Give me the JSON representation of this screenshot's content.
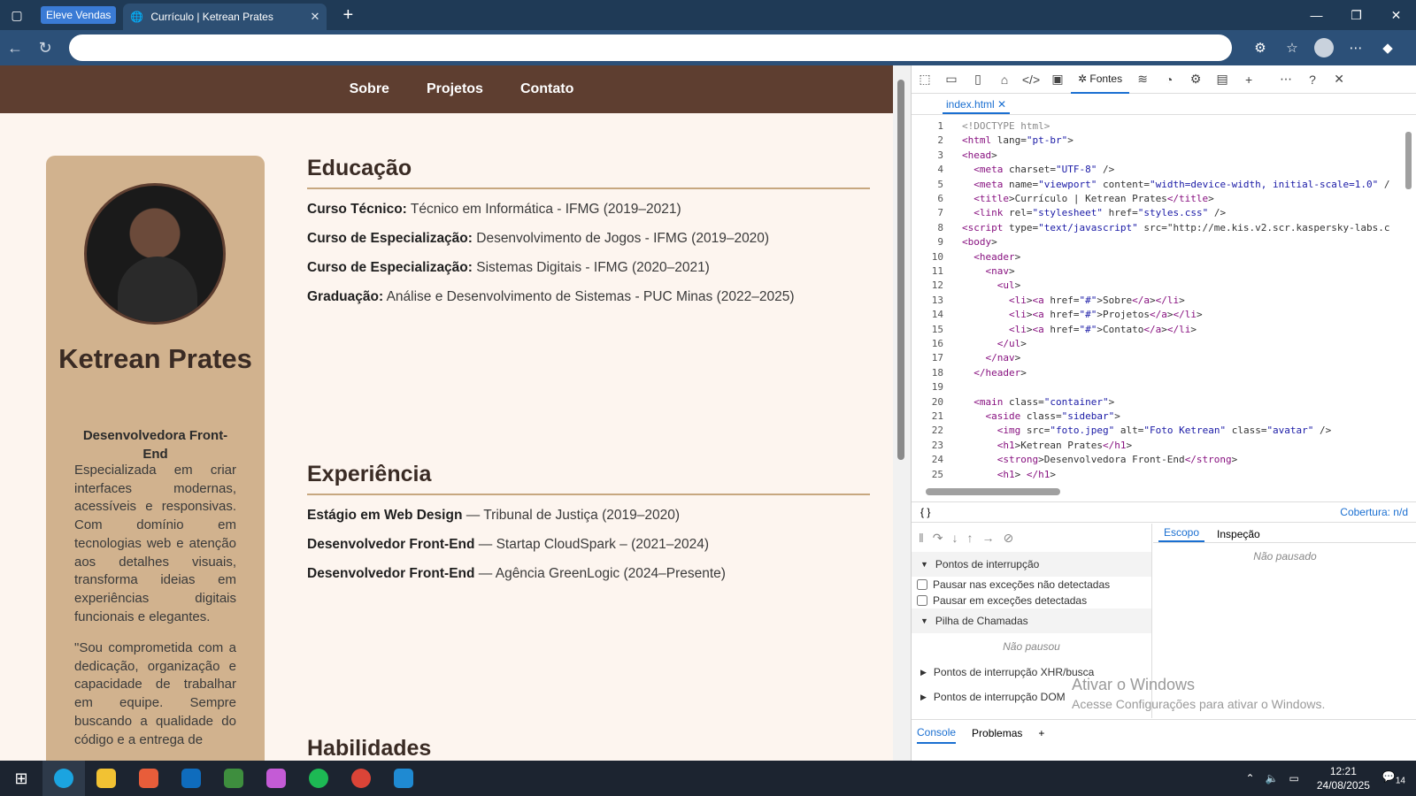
{
  "browser": {
    "group_label": "Eleve Vendas",
    "tab_title": "Currículo | Ketrean Prates",
    "url": "",
    "controls": {
      "min": "—",
      "max": "❐",
      "close": "✕"
    }
  },
  "site": {
    "nav": [
      "Sobre",
      "Projetos",
      "Contato"
    ],
    "sidebar": {
      "name": "Ketrean Prates",
      "role": "Desenvolvedora Front-End",
      "bio": "Especializada em criar interfaces modernas, acessíveis e responsivas. Com domínio em tecnologias web e atenção aos detalhes visuais, transforma ideias em experiências digitais funcionais e elegantes.",
      "quote": "\"Sou comprometida com a dedicação, organização e capacidade de trabalhar em equipe. Sempre buscando a qualidade do código e a entrega de"
    },
    "education": {
      "title": "Educação",
      "items": [
        {
          "label": "Curso Técnico:",
          "text": "Técnico em Informática - IFMG (2019–2021)"
        },
        {
          "label": "Curso de Especialização:",
          "text": "Desenvolvimento de Jogos - IFMG (2019–2020)"
        },
        {
          "label": "Curso de Especialização:",
          "text": "Sistemas Digitais - IFMG (2020–2021)"
        },
        {
          "label": "Graduação:",
          "text": "Análise e Desenvolvimento de Sistemas - PUC Minas (2022–2025)"
        }
      ]
    },
    "experience": {
      "title": "Experiência",
      "items": [
        {
          "label": "Estágio em Web Design",
          "text": "— Tribunal de Justiça (2019–2020)"
        },
        {
          "label": "Desenvolvedor Front-End",
          "text": "— Startap CloudSpark – (2021–2024)"
        },
        {
          "label": "Desenvolvedor Front-End",
          "text": "— Agência GreenLogic (2024–Presente)"
        }
      ]
    },
    "skills": {
      "title": "Habilidades"
    }
  },
  "devtools": {
    "active_tool": "Fontes",
    "file": "index.html",
    "code_lines": [
      "<!DOCTYPE html>",
      "<html lang=\"pt-br\">",
      "<head>",
      "  <meta charset=\"UTF-8\" />",
      "  <meta name=\"viewport\" content=\"width=device-width, initial-scale=1.0\" /",
      "  <title>Currículo | Ketrean Prates</title>",
      "  <link rel=\"stylesheet\" href=\"styles.css\" />",
      "<script type=\"text/javascript\" src=\"http://me.kis.v2.scr.kaspersky-labs.c",
      "<body>",
      "  <header>",
      "    <nav>",
      "      <ul>",
      "        <li><a href=\"#\">Sobre</a></li>",
      "        <li><a href=\"#\">Projetos</a></li>",
      "        <li><a href=\"#\">Contato</a></li>",
      "      </ul>",
      "    </nav>",
      "  </header>",
      "",
      "  <main class=\"container\">",
      "    <aside class=\"sidebar\">",
      "      <img src=\"foto.jpeg\" alt=\"Foto Ketrean\" class=\"avatar\" />",
      "      <h1>Ketrean Prates</h1>",
      "      <strong>Desenvolvedora Front-End</strong>",
      "      <h1> </h1>"
    ],
    "braces": "{ }",
    "coverage": "Cobertura: n/d",
    "breakpoints": "Pontos de interrupção",
    "pause_uncaught": "Pausar nas exceções não detectadas",
    "pause_caught": "Pausar em exceções detectadas",
    "call_stack": "Pilha de Chamadas",
    "not_paused": "Não pausou",
    "xhr_bp": "Pontos de interrupção XHR/busca",
    "dom_bp": "Pontos de interrupção DOM",
    "scope_tab": "Escopo",
    "watch_tab": "Inspeção",
    "scope_status": "Não pausado",
    "drawer": [
      "Console",
      "Problemas"
    ]
  },
  "windows_notice": {
    "title": "Ativar o Windows",
    "sub": "Acesse Configurações para ativar o Windows."
  },
  "taskbar": {
    "time": "12:21",
    "date": "24/08/2025",
    "notifications": "14"
  },
  "colors": {
    "nav_bg": "#5e3e30",
    "sidebar_bg": "#d1b28e",
    "page_bg": "#fdf5ef",
    "accent": "#1a6fd1"
  }
}
